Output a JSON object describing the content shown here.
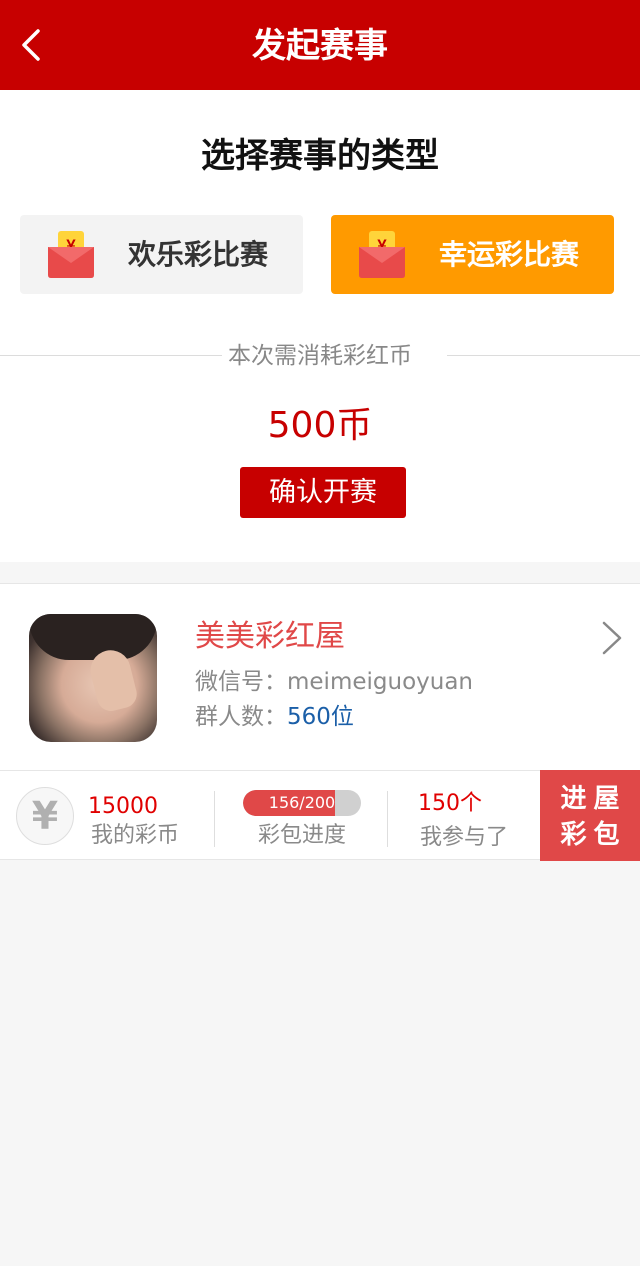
{
  "header": {
    "title": "发起赛事"
  },
  "type_section": {
    "title": "选择赛事的类型",
    "options": [
      {
        "label": "欢乐彩比赛",
        "selected": false
      },
      {
        "label": "幸运彩比赛",
        "selected": true
      }
    ]
  },
  "cost": {
    "label": "本次需消耗彩红币",
    "amount": "500币",
    "confirm_label": "确认开赛"
  },
  "profile": {
    "name": "美美彩红屋",
    "wechat": "微信号：meimeiguoyuan",
    "members_label": "群人数：",
    "members_count": "560位"
  },
  "stats": {
    "coin_symbol": "¥",
    "coins_value": "15000",
    "coins_label": "我的彩币",
    "progress_text": "156/200",
    "progress_fraction": 0.78,
    "progress_label": "彩包进度",
    "joined_value": "150个",
    "joined_label": "我参与了",
    "enter_line1": "进屋",
    "enter_line2": "彩包"
  },
  "colors": {
    "header": "#c70000",
    "selected_option": "#ff9a00",
    "accent_red": "#e04848",
    "link_blue": "#1b5fa8"
  }
}
